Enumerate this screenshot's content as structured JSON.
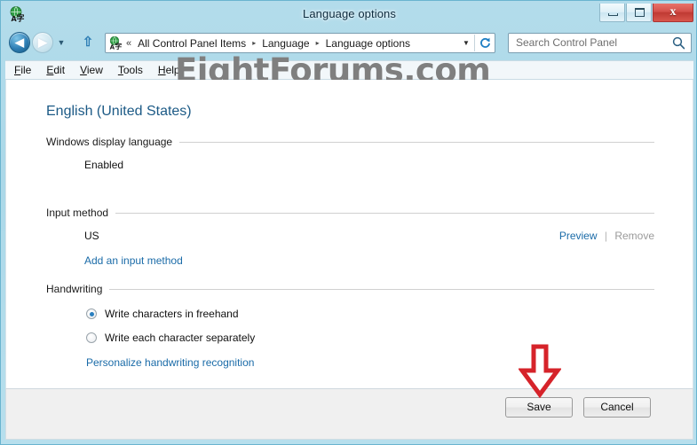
{
  "window": {
    "title": "Language options",
    "icon": "language-globe-icon",
    "controls": {
      "minimize": "minimize-button",
      "maximize": "maximize-button",
      "close_label": "x"
    }
  },
  "navbar": {
    "back_glyph": "◀",
    "forward_glyph": "▶",
    "history_glyph": "▼",
    "up_glyph": "⇧",
    "breadcrumb_prefix": "«",
    "breadcrumbs": [
      "All Control Panel Items",
      "Language",
      "Language options"
    ],
    "separator": "▸",
    "dropdown_glyph": "▼",
    "refresh_title": "refresh-button"
  },
  "search": {
    "placeholder": "Search Control Panel",
    "icon": "search-icon"
  },
  "menubar": {
    "items": [
      {
        "access": "F",
        "rest": "ile"
      },
      {
        "access": "E",
        "rest": "dit"
      },
      {
        "access": "V",
        "rest": "iew"
      },
      {
        "access": "T",
        "rest": "ools"
      },
      {
        "access": "H",
        "rest": "elp"
      }
    ]
  },
  "watermark": {
    "text": "EightForums.com"
  },
  "content": {
    "page_title": "English (United States)",
    "sections": [
      {
        "id": "display-language",
        "heading": "Windows display language",
        "value": "Enabled"
      },
      {
        "id": "input-method",
        "heading": "Input method",
        "value": "US",
        "actions": {
          "preview": "Preview",
          "separator": "|",
          "remove": "Remove"
        },
        "add_link": "Add an input method"
      },
      {
        "id": "handwriting",
        "heading": "Handwriting",
        "options": [
          {
            "label": "Write characters in freehand",
            "checked": true
          },
          {
            "label": "Write each character separately",
            "checked": false
          }
        ],
        "personalize_link": "Personalize handwriting recognition"
      }
    ]
  },
  "footer": {
    "save_label": "Save",
    "cancel_label": "Cancel"
  },
  "annotation": {
    "arrow": "red-down-arrow",
    "color": "#d6232a"
  },
  "colors": {
    "accent_link": "#1a6ba8",
    "title_heading": "#1c5a86",
    "frame": "#b3dceb",
    "close_button": "#c9403a",
    "watermark": "#7f7f7f"
  }
}
